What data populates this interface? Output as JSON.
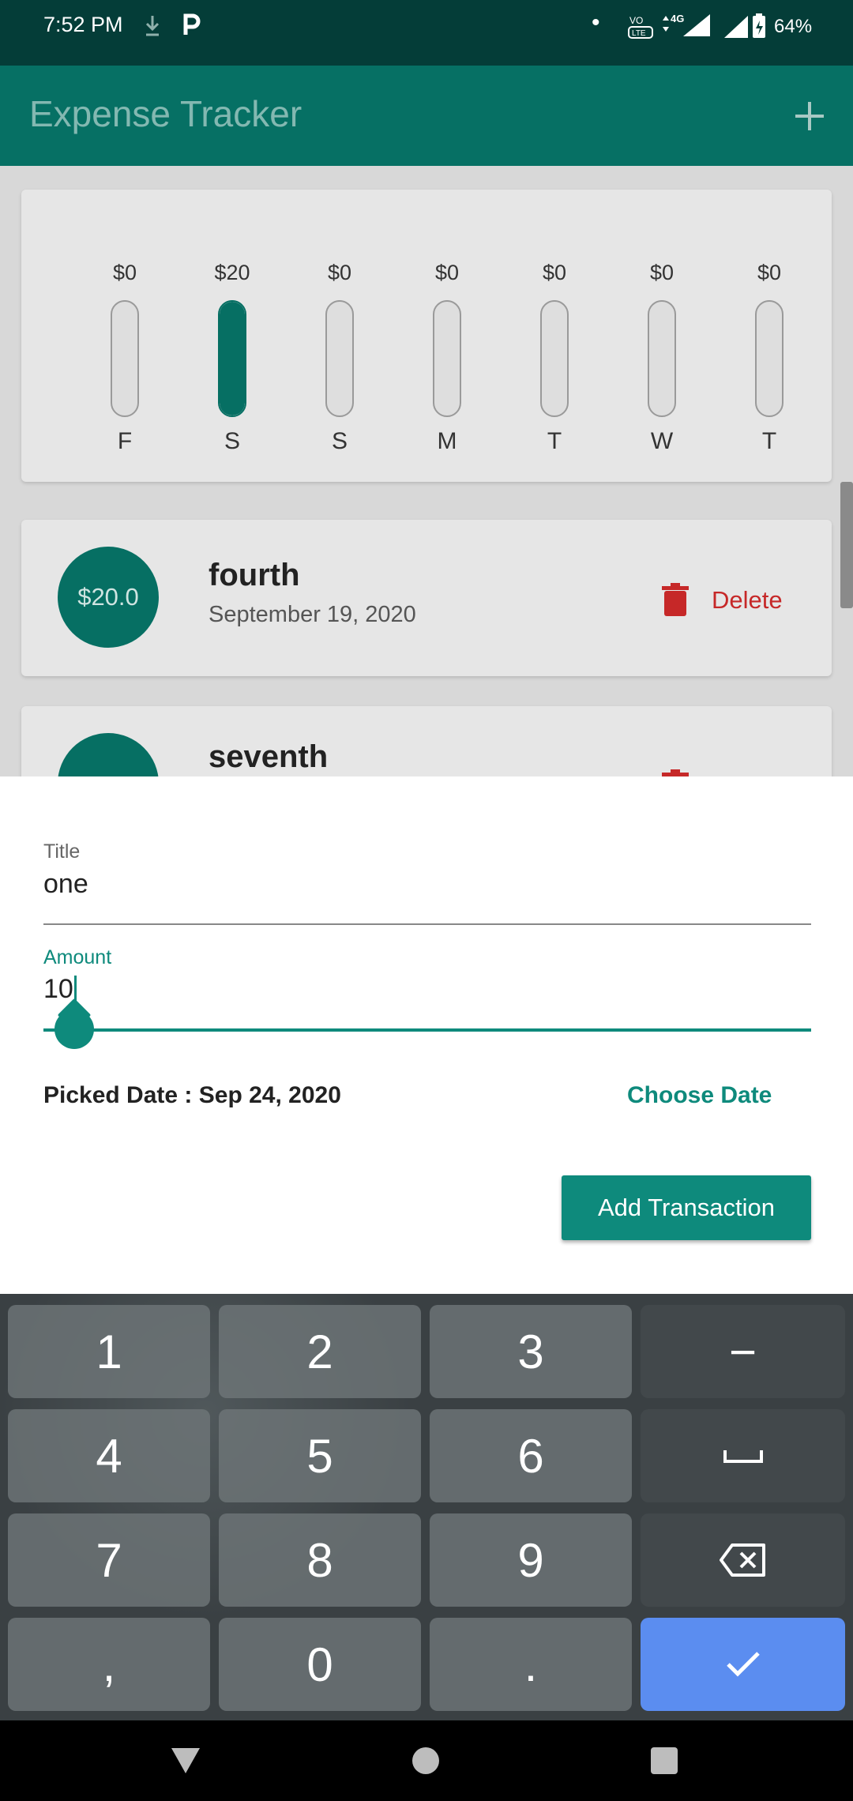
{
  "status_bar": {
    "time": "7:52 PM",
    "icons": [
      "download-icon",
      "parking-icon",
      "dot-icon",
      "volte-icon",
      "4g-icon",
      "signal-icon",
      "signal-icon",
      "battery-icon"
    ],
    "battery": "64%"
  },
  "app_bar": {
    "title": "Expense Tracker",
    "add_icon": "plus-icon"
  },
  "chart": {
    "bars": [
      {
        "amount": "$0",
        "day": "F",
        "fill": 0
      },
      {
        "amount": "$20",
        "day": "S",
        "fill": 1
      },
      {
        "amount": "$0",
        "day": "S",
        "fill": 0
      },
      {
        "amount": "$0",
        "day": "M",
        "fill": 0
      },
      {
        "amount": "$0",
        "day": "T",
        "fill": 0
      },
      {
        "amount": "$0",
        "day": "W",
        "fill": 0
      },
      {
        "amount": "$0",
        "day": "T",
        "fill": 0
      }
    ]
  },
  "transactions": [
    {
      "amount": "$20.0",
      "title": "fourth",
      "date": "September 19, 2020",
      "delete_label": "Delete"
    },
    {
      "amount": "",
      "title": "seventh",
      "date": "",
      "delete_label": ""
    }
  ],
  "form": {
    "title_label": "Title",
    "title_value": "one",
    "amount_label": "Amount",
    "amount_value": "10",
    "picked_date": "Picked Date : Sep 24, 2020",
    "choose_date": "Choose Date",
    "submit": "Add Transaction",
    "colors": {
      "accent": "#0e8a7c",
      "dark": "#066f63"
    }
  },
  "keyboard": {
    "rows": [
      [
        "1",
        "2",
        "3",
        "−"
      ],
      [
        "4",
        "5",
        "6",
        "␣"
      ],
      [
        "7",
        "8",
        "9",
        "⌫"
      ],
      [
        ",",
        "0",
        ".",
        "✓"
      ]
    ]
  },
  "nav": {
    "back": "back-icon",
    "home": "home-icon",
    "recents": "recents-icon"
  }
}
